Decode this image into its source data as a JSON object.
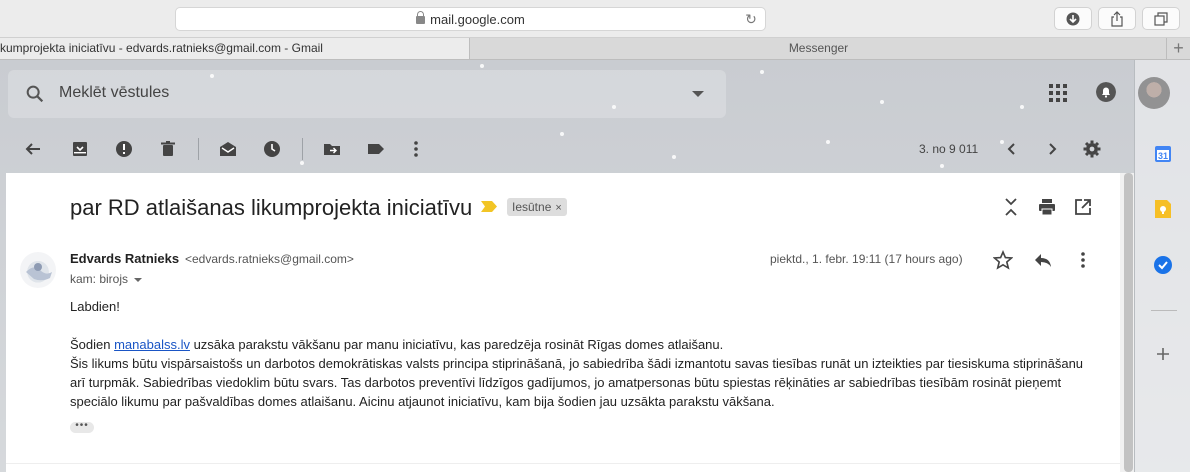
{
  "browser": {
    "url": "mail.google.com",
    "tabs": [
      {
        "label": "kumprojekta iniciatīvu - edvards.ratnieks@gmail.com - Gmail",
        "active": true
      },
      {
        "label": "Messenger",
        "active": false
      }
    ]
  },
  "search": {
    "placeholder": "Meklēt vēstules"
  },
  "toolbar": {
    "pager": "3. no 9 011"
  },
  "message": {
    "subject": "par RD atlaišanas likumprojekta iniciatīvu",
    "label": "Iesūtne",
    "label_remove": "×",
    "sender_name": "Edvards Ratnieks",
    "sender_email": "<edvards.ratnieks@gmail.com>",
    "recipient": "kam: birojs",
    "date": "piektd., 1. febr. 19:11 (17 hours ago)",
    "greeting": "Labdien!",
    "line1_prefix": "Šodien ",
    "line1_link": "manabalss.lv",
    "line1_suffix": " uzsāka parakstu vākšanu par manu iniciatīvu, kas paredzēja rosināt Rīgas domes atlaišanu.",
    "line2": "Šis likums būtu vispārsaistošs un darbotos demokrātiskas valsts principa stiprināšanā, jo sabiedrība šādi izmantotu savas tiesības runāt un izteikties par tiesiskuma stiprināšanu",
    "line3": "arī turpmāk. Sabiedrības viedoklim būtu svars. Tas darbotos preventīvi līdzīgos gadījumos, jo amatpersonas būtu spiestas rēķināties ar sabiedrības tiesībām rosināt pieņemt",
    "line4": "speciālo likumu par pašvaldības domes atlaišanu. Aicinu atjaunot iniciatīvu, kam bija šodien jau uzsākta parakstu vākšana.",
    "ellipsis": "•••"
  },
  "side_panel": {
    "calendar_day": "31"
  },
  "colors": {
    "important_marker": "#f2c526",
    "link": "#1a55c5",
    "calendar": "#4285f4",
    "keep": "#f6bf26",
    "tasks": "#1a73e8"
  }
}
